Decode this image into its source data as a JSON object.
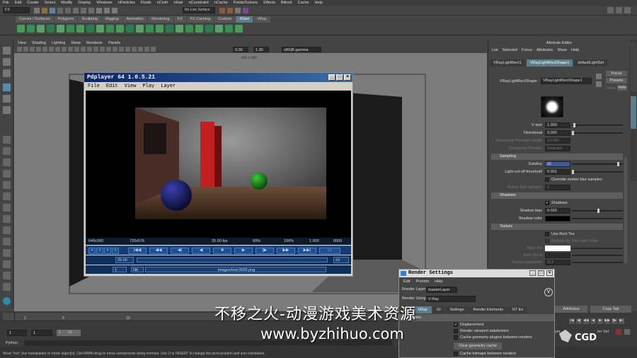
{
  "maya": {
    "menus": [
      "File",
      "Edit",
      "Create",
      "Select",
      "Modify",
      "Display",
      "Windows",
      "nParticles",
      "Fluids",
      "nCloth",
      "nHair",
      "nConstraint",
      "nCache",
      "Fields/Solvers",
      "Effects",
      "Bifrost",
      "Cache",
      "Help"
    ],
    "menuset": "FX",
    "live_surface": "No Live Surface",
    "shelf_tabs": [
      "Curves / Surfaces",
      "Polygons",
      "Sculpting",
      "Rigging",
      "Animation",
      "Rendering",
      "FX",
      "FX Caching",
      "Custom",
      "XGen",
      "VRay"
    ],
    "active_shelf_tab": "XGen"
  },
  "viewport": {
    "menus": [
      "View",
      "Shading",
      "Lighting",
      "Show",
      "Renderer",
      "Panels"
    ],
    "exposure": "0.00",
    "gamma": "1.00",
    "color_space": "sRGB gamma",
    "resolution": "640 x 360"
  },
  "pdplayer": {
    "title": "Pdplayer 64 1.0.5.21",
    "menus": [
      "File",
      "Edit",
      "View",
      "Play",
      "Layer"
    ],
    "status": {
      "res1": "640x360",
      "res2": "720x576",
      "fps": "25.00 fps",
      "pct1": "69%",
      "pct2": "100%",
      "ratio": "1.000",
      "frame": "0009"
    },
    "seek_start": "25.00",
    "seek_end": "10",
    "layer_index": "1",
    "layer_label": "Nb",
    "file_path": "images/test.0009.png"
  },
  "attribute_editor": {
    "header": "Attribute Editor",
    "menus": [
      "List",
      "Selected",
      "Focus",
      "Attributes",
      "Show",
      "Help"
    ],
    "tabs": [
      "VRayLightRect1",
      "VRayLightRectShape1",
      "defaultLightSet"
    ],
    "active_tab": "VRayLightRectShape1",
    "node_label": "VRayLightRectShape:",
    "node_name": "VRayLightRectShape1",
    "buttons": {
      "focus": "Focus",
      "presets": "Presets",
      "show": "Show",
      "hide": "Hide"
    },
    "sample_label": "Sample",
    "rows": {
      "v_size": {
        "label": "V size",
        "value": "1.000"
      },
      "directional": {
        "label": "Directional",
        "value": "0.000"
      },
      "dir_preview_length": {
        "label": "Directional Preview Length",
        "value": "10.000"
      },
      "dir_preview": {
        "label": "Directional Preview",
        "value": "Selected"
      }
    },
    "sampling": {
      "title": "Sampling",
      "subdivs": {
        "label": "Subdivs",
        "value": "32"
      },
      "cutoff": {
        "label": "Light cut-off threshold",
        "value": "0.001"
      },
      "override": "Override motion blur samples",
      "motion_blur": {
        "label": "Motion blur samples",
        "value": "2"
      }
    },
    "shadows": {
      "title": "Shadows",
      "shadows_check": "Shadows",
      "bias": {
        "label": "Shadow bias",
        "value": "0.020"
      },
      "color_label": "Shadow color"
    },
    "texture": {
      "title": "Texture",
      "use_rect_tex": "Use Rect Tex",
      "multiply": "Multiply By The Light Color",
      "rect_tex": "Rect Tex",
      "rect_tex_a": "Rect Tex A",
      "tex_res": {
        "label": "Texture resolution",
        "value": "512"
      }
    },
    "bottom_buttons": {
      "attributes": "Attributes",
      "copy_tab": "Copy Tab"
    },
    "side_tabs": [
      "Channel Box / Layer Editor",
      "Attribute Editor"
    ]
  },
  "render_settings": {
    "title": "Render Settings",
    "menus": [
      "Edit",
      "Presets",
      "Help"
    ],
    "render_layer_label": "Render Layer",
    "render_layer": "masterLayer",
    "render_using_label": "Render Using",
    "render_using": "V-Ray",
    "tabs": [
      "ion",
      "VRay",
      "GI",
      "Settings",
      "Render Elements",
      "RT En"
    ],
    "active_tab": "VRay",
    "section": "Options",
    "displacement": "Displacement",
    "viewport_subdiv": "Render viewport subdivision",
    "cache_plugins": "Cache geometry plugins between renders",
    "clear_cache": "Clear geometry cache",
    "cache_bitmaps": "Cache bitmaps between renders"
  },
  "timeline": {
    "ticks": [
      "1",
      "5",
      "10"
    ],
    "range_start": "1",
    "range_inner_start": "1",
    "range_inner_end": "1",
    "range_mid": "10",
    "character_set": "ter Set",
    "anim_layer": "yer"
  },
  "command": {
    "label": "Python"
  },
  "help_line": "Move Tool: Use manipulator to move object(s). Ctrl+MMB+drag to move components along normals. Use D or INSERT to change the pivot position and axis orientation.",
  "watermark": {
    "text": "不移之火-动漫游戏美术资源",
    "url": "www.byzhihuo.com",
    "logo": "CGD"
  },
  "colors": {
    "accent": "#5d7d8c",
    "pd_blue": "#153b70",
    "xp_title": "#0a246a"
  }
}
